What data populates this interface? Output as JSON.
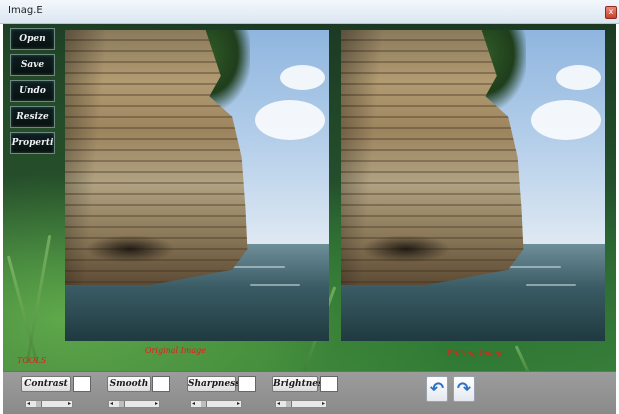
{
  "window": {
    "title": "Imag.E",
    "close_glyph": "x"
  },
  "side_menu": [
    {
      "label": "Open"
    },
    {
      "label": "Save"
    },
    {
      "label": "Undo"
    },
    {
      "label": "Resize"
    },
    {
      "label": "Properti"
    }
  ],
  "labels": {
    "tools": "TOOLS",
    "original": "Original Image",
    "editing": "Editing Image"
  },
  "tools": [
    {
      "label": "Contrast"
    },
    {
      "label": "Smooth"
    },
    {
      "label": "Sharpness"
    },
    {
      "label": "Brightness"
    }
  ],
  "history": {
    "undo_icon": "↶",
    "redo_icon": "↷"
  },
  "colors": {
    "label_red": "#e0201a",
    "arrow_blue": "#2f6fc5"
  }
}
